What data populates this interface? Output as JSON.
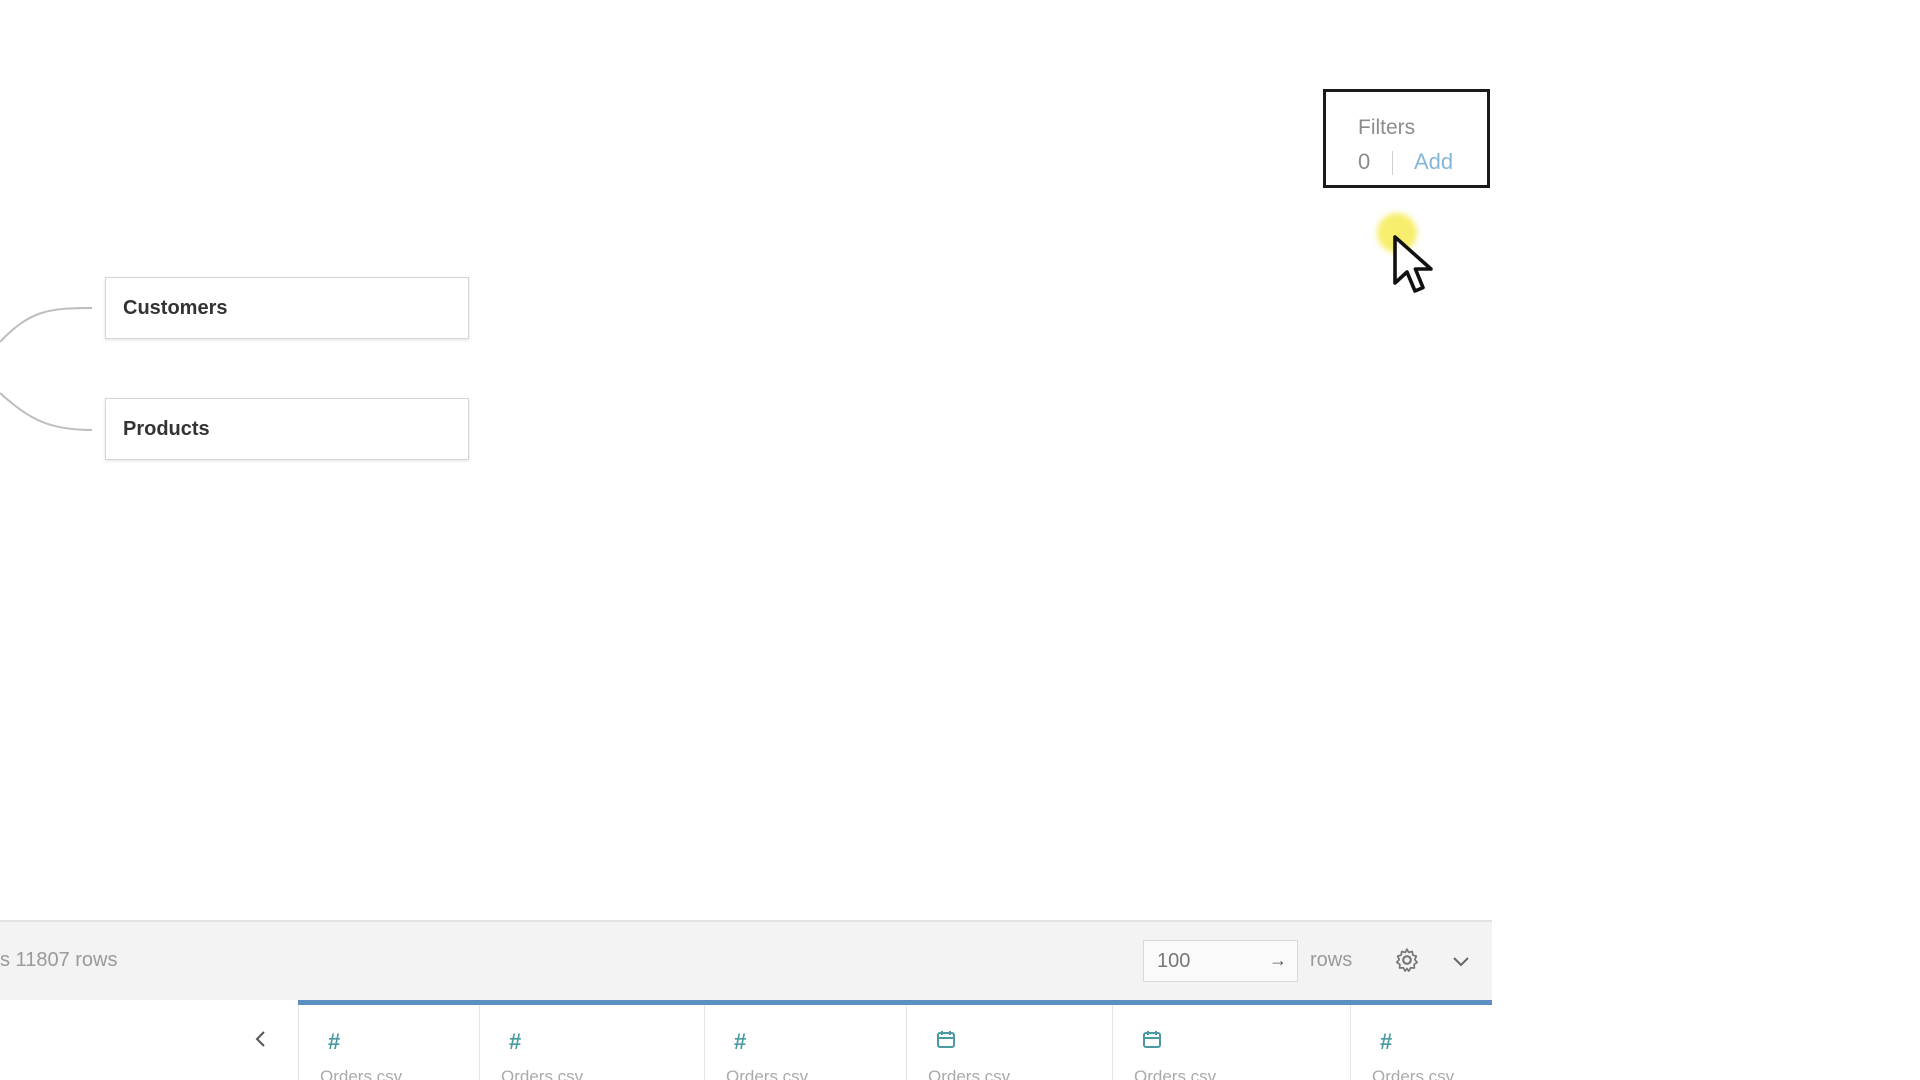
{
  "canvas": {
    "tables": [
      {
        "name": "Customers"
      },
      {
        "name": "Products"
      }
    ]
  },
  "filters": {
    "title": "Filters",
    "count": "0",
    "add_label": "Add"
  },
  "grid_toolbar": {
    "row_count_text": "s 11807 rows",
    "rows_input_value": "100",
    "rows_label": "rows"
  },
  "grid_columns": [
    {
      "type_icon": "number-icon",
      "source": "Orders.csv"
    },
    {
      "type_icon": "number-icon",
      "source": "Orders.csv"
    },
    {
      "type_icon": "number-icon",
      "source": "Orders.csv"
    },
    {
      "type_icon": "date-icon",
      "source": "Orders.csv"
    },
    {
      "type_icon": "date-icon",
      "source": "Orders.csv"
    },
    {
      "type_icon": "number-icon",
      "source": "Orders.csv"
    }
  ],
  "colors": {
    "accent": "#5a8fc0",
    "field_icon": "#4a9aa3",
    "add_link": "#86b6d6",
    "cursor_highlight": "#f5e83c"
  }
}
